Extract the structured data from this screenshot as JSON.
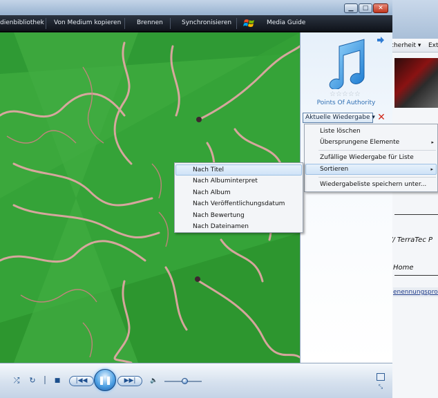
{
  "window": {
    "min_glyph": "▁",
    "max_glyph": "□",
    "close_glyph": "✕"
  },
  "nav": {
    "items": [
      {
        "label": "dienbibliothek"
      },
      {
        "label": "Von Medium kopieren"
      },
      {
        "label": "Brennen"
      },
      {
        "label": "Synchronisieren"
      },
      {
        "label": "Media Guide"
      }
    ]
  },
  "now_playing": {
    "rating_stars": "☆☆☆☆☆",
    "album_title": "Points Of Authority",
    "dropdown_label": "Aktuelle Wiedergabe ▾",
    "clear_glyph": "✕"
  },
  "main_menu": {
    "items": [
      {
        "label": "Liste löschen"
      },
      {
        "label": "Übersprungene Elemente",
        "arrow": "▸"
      },
      {
        "label": "Zufällige Wiedergabe für Liste"
      },
      {
        "label": "Sortieren",
        "arrow": "▸"
      },
      {
        "label": "Wiedergabeliste speichern unter..."
      }
    ]
  },
  "sort_menu": {
    "items": [
      {
        "label": "Nach Titel"
      },
      {
        "label": "Nach Albuminterpret"
      },
      {
        "label": "Nach Album"
      },
      {
        "label": "Nach Veröffentlichungsdatum"
      },
      {
        "label": "Nach Bewertung"
      },
      {
        "label": "Nach Dateinamen"
      }
    ]
  },
  "transport": {
    "shuffle_glyph": "⤮",
    "repeat_glyph": "↻",
    "stop_glyph": "■",
    "prev_glyph": "|◀◀",
    "play_glyph": "❚❚",
    "next_glyph": "▶▶|",
    "volume_glyph": "🔈",
    "volume_level": 0.55
  },
  "background_window": {
    "toolbar_items": [
      {
        "label": "cherheit ▾"
      },
      {
        "label": "Ext"
      }
    ],
    "text_lines": [
      {
        "label": "// TerraTec P"
      },
      {
        "label": "Home"
      }
    ],
    "link_text": "enennungsproz"
  }
}
